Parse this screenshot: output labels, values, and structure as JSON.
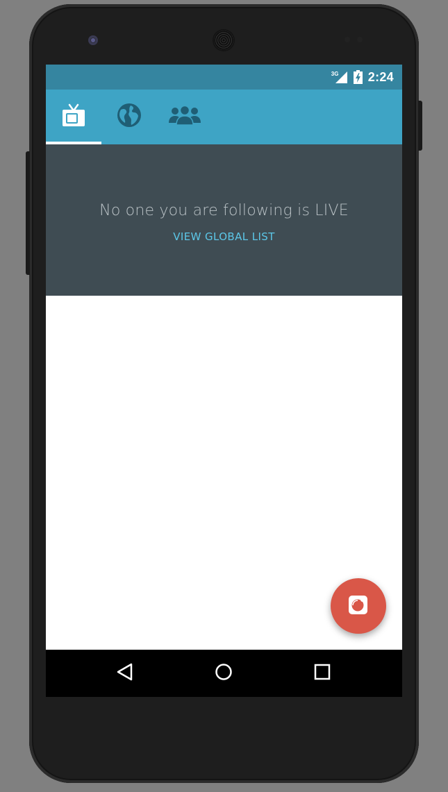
{
  "status_bar": {
    "network": "3G",
    "time": "2:24",
    "icons": [
      "signal-icon",
      "battery-charging-icon"
    ]
  },
  "tabs": [
    {
      "icon": "tv-icon",
      "selected": true
    },
    {
      "icon": "globe-icon",
      "selected": false
    },
    {
      "icon": "people-icon",
      "selected": false
    }
  ],
  "empty_state": {
    "message": "No one you are following is LIVE",
    "link_label": "VIEW GLOBAL LIST"
  },
  "fab": {
    "icon": "broadcast-camera-icon"
  },
  "nav": {
    "icons": [
      "back-icon",
      "home-icon",
      "recents-icon"
    ]
  },
  "colors": {
    "status_bar": "#3585a0",
    "tab_bar": "#3ea4c5",
    "panel": "#3f4c53",
    "link": "#5cc7e8",
    "fab": "#d95748"
  }
}
